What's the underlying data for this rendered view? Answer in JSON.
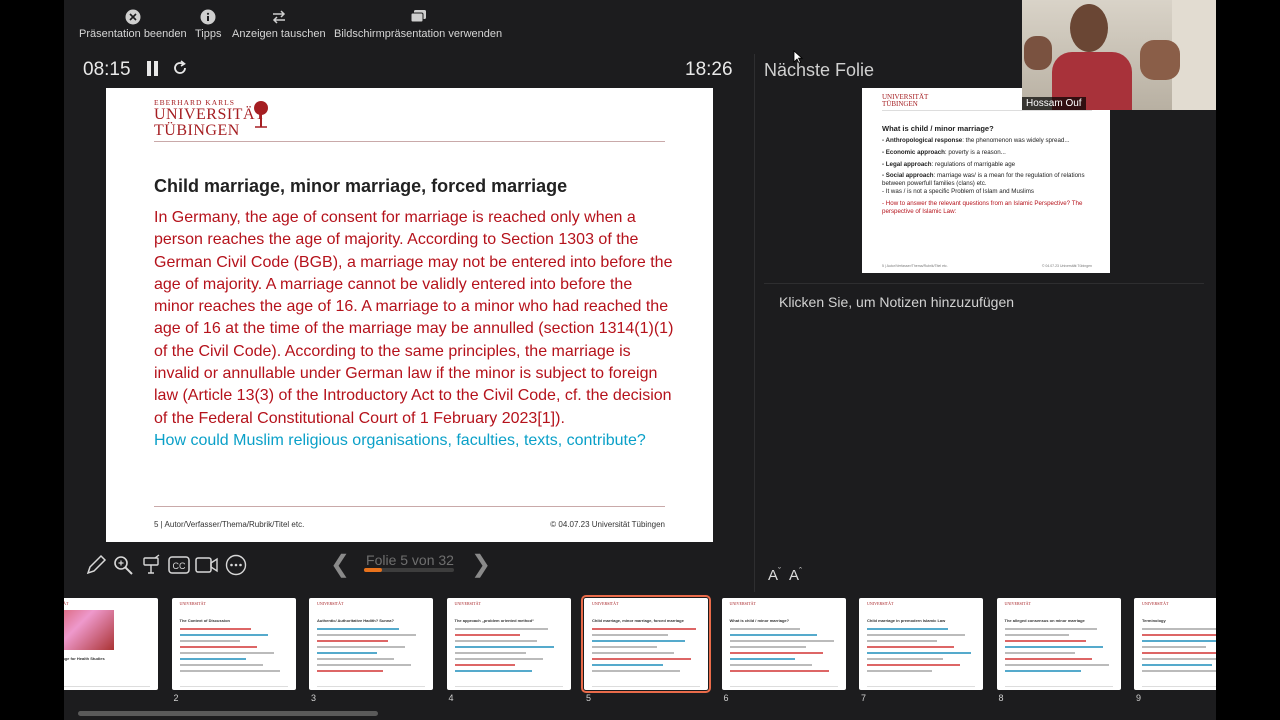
{
  "toolbar": {
    "end": "Präsentation beenden",
    "tips": "Tipps",
    "swap": "Anzeigen tauschen",
    "screen": "Bildschirmpräsentation verwenden"
  },
  "timers": {
    "elapsed": "08:15",
    "clock": "18:26"
  },
  "slide": {
    "logo_line1": "EBERHARD KARLS",
    "logo_line2": "UNIVERSITÄT",
    "logo_line3": "TÜBINGEN",
    "title": "Child marriage, minor marriage, forced marriage",
    "body": "In Germany, the age of consent for marriage is reached only when a person reaches the age of majority. According to Section 1303 of the German Civil Code (BGB), a marriage may not be entered into before the age of majority. A marriage cannot be validly entered into before the minor reaches the age of 16. A marriage to a minor who had reached the age of 16 at the time of the marriage may be annulled (section 1314(1)(1) of the Civil Code). According to the same principles, the marriage is invalid or annullable under German law if the minor is subject to foreign law (Article 13(3) of the Introductory Act to the Civil Code, cf. the decision of the Federal Constitutional Court of 1 February 2023[1]).",
    "question": "How could Muslim religious organisations, faculties, texts, contribute?",
    "footer_left": "5 | Autor/Verfasser/Thema/Rubrik/Titel etc.",
    "footer_right": "© 04.07.23 Universität Tübingen"
  },
  "nav": {
    "slide_counter": "Folie 5 von 32",
    "progress": 0.2
  },
  "next": {
    "label": "Nächste Folie",
    "title": "What is child / minor marriage?",
    "items": [
      {
        "bold": "- Anthropological response",
        "text": ": the phenomenon was widely spread..."
      },
      {
        "bold": "- Economic approach",
        "text": ": poverty is a reason..."
      },
      {
        "bold": "- Legal approach",
        "text": ": regulations of marrigable age"
      },
      {
        "bold": "- Social approach",
        "text": ": marriage was/ is a mean for the regulation of relations between powerfull families (clans) etc."
      }
    ],
    "plain": "- It was / is not a specific Problem of Islam and Muslims",
    "red": "- How to answer the relevant questions from an Islamic Perspective? The perspective of Islamic Law:"
  },
  "notes": {
    "placeholder": "Klicken Sie, um Notizen hinzuzufügen"
  },
  "font_controls": {
    "decrease": "A",
    "increase": "A"
  },
  "thumbnails": [
    {
      "num": "",
      "title": "as a challenge for Health Studies"
    },
    {
      "num": "2",
      "title": "The Context of Discussion"
    },
    {
      "num": "3",
      "title": "Authentic/ Authoritative Hadith? Sunna?"
    },
    {
      "num": "4",
      "title": "The approach „problem oriented method“"
    },
    {
      "num": "5",
      "title": "Child marriage, minor marriage, forced marriage"
    },
    {
      "num": "6",
      "title": "What is child / minor marriage?"
    },
    {
      "num": "7",
      "title": "Child marriage in premodern Islamic Law"
    },
    {
      "num": "8",
      "title": "The alleged consensus on minor marriage"
    },
    {
      "num": "9",
      "title": "Terminology"
    }
  ],
  "video": {
    "name": "Hossam Ouf"
  }
}
